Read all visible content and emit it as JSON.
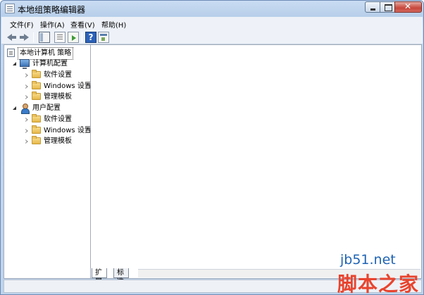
{
  "window": {
    "title": "本地组策略编辑器"
  },
  "menu": {
    "items": [
      {
        "label": "文件(F)"
      },
      {
        "label": "操作(A)"
      },
      {
        "label": "查看(V)"
      },
      {
        "label": "帮助(H)"
      }
    ]
  },
  "toolbar": {
    "icons": [
      "back-arrow-icon",
      "forward-arrow-icon",
      "show-hide-tree-icon",
      "list-view-icon",
      "export-list-icon",
      "help-icon",
      "properties-icon"
    ]
  },
  "tree": {
    "root": {
      "label": "本地计算机 策略"
    },
    "computer_config": {
      "label": "计算机配置",
      "children": [
        {
          "label": "软件设置"
        },
        {
          "label": "Windows 设置"
        },
        {
          "label": "管理模板"
        }
      ]
    },
    "user_config": {
      "label": "用户配置",
      "children": [
        {
          "label": "软件设置"
        },
        {
          "label": "Windows 设置"
        },
        {
          "label": "管理模板"
        }
      ]
    }
  },
  "tabs": [
    {
      "label": "扩展"
    },
    {
      "label": "标准"
    }
  ],
  "watermark": {
    "site": "jb51.net",
    "name": "脚本之家"
  },
  "colors": {
    "window_frame": "#bfd3ec",
    "close_button": "#c7463a",
    "folder": "#e6b84b",
    "watermark_site": "#1e63b4",
    "watermark_name": "#e8442e"
  }
}
